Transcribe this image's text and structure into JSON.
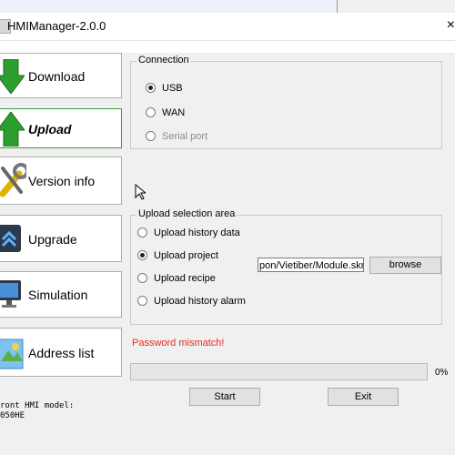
{
  "window": {
    "title": "HMIManager-2.0.0"
  },
  "nav": {
    "items": [
      {
        "label": "Download",
        "icon": "down-arrow-icon"
      },
      {
        "label": "Upload",
        "icon": "up-arrow-icon",
        "active": true
      },
      {
        "label": "Version info",
        "icon": "wrench-icon"
      },
      {
        "label": "Upgrade",
        "icon": "upgrade-icon"
      },
      {
        "label": "Simulation",
        "icon": "monitor-icon"
      },
      {
        "label": "Address list",
        "icon": "address-list-icon"
      }
    ]
  },
  "connection": {
    "legend": "Connection",
    "options": [
      {
        "label": "USB",
        "checked": true
      },
      {
        "label": "WAN",
        "checked": false
      },
      {
        "label": "Serial port",
        "checked": false,
        "disabled": true
      }
    ]
  },
  "upload_area": {
    "legend": "Upload selection area",
    "options": [
      {
        "label": "Upload history data",
        "checked": false
      },
      {
        "label": "Upload project",
        "checked": true
      },
      {
        "label": "Upload recipe",
        "checked": false
      },
      {
        "label": "Upload history alarm",
        "checked": false
      }
    ],
    "path_value": "pon/Vietiber/Module.skr",
    "browse_label": "browse"
  },
  "status": {
    "error": "Password mismatch!",
    "progress": 0,
    "progress_text": "0%"
  },
  "actions": {
    "start_label": "Start",
    "exit_label": "Exit"
  },
  "model_info": "ront HMI model:\n050HE",
  "colors": {
    "error": "#e8281e",
    "active_border": "#3c9b3c",
    "arrow_green": "#2e9e2e"
  }
}
